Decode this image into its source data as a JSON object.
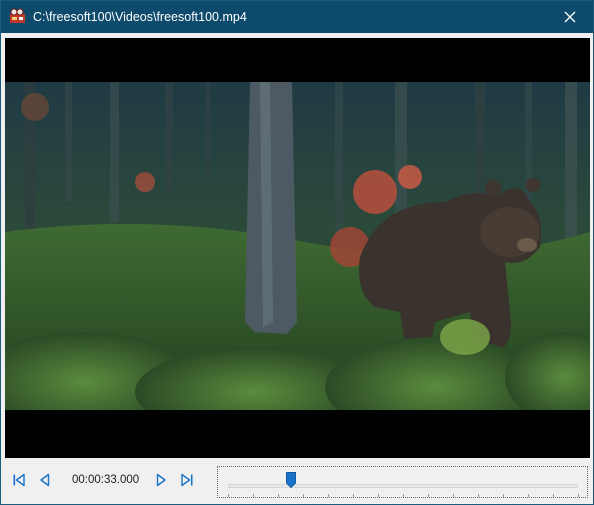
{
  "window": {
    "title": "C:\\freesoft100\\Videos\\freesoft100.mp4",
    "icon": "film-projector-icon",
    "close_icon": "close-icon"
  },
  "player": {
    "current_time": "00:00:33.000",
    "progress_fraction": 0.18,
    "tick_count": 15,
    "controls": {
      "first": "skip-to-start-icon",
      "prev": "previous-frame-icon",
      "next": "next-frame-icon",
      "last": "skip-to-end-icon"
    },
    "accent": "#1a73c9"
  },
  "colors": {
    "titlebar": "#0d4a6b",
    "background": "#f0f0f0",
    "video_bg": "#000000"
  }
}
